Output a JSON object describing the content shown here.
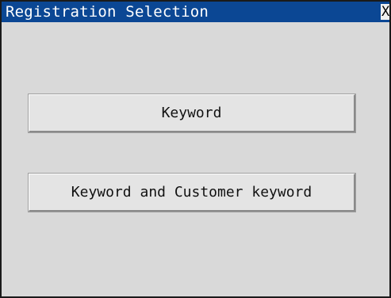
{
  "window": {
    "title": "Registration Selection",
    "close_label": "X"
  },
  "buttons": {
    "keyword_label": "Keyword",
    "keyword_customer_label": "Keyword and Customer keyword"
  },
  "colors": {
    "titlebar": "#0b4794",
    "background": "#d9d9d9",
    "button": "#e4e4e4"
  }
}
